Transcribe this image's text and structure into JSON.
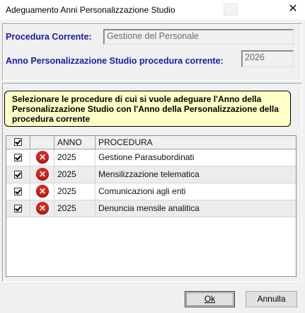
{
  "window": {
    "title": "Adeguamento Anni Personalizzazione Studio"
  },
  "header": {
    "procedura_label": "Procedura Corrente:",
    "procedura_value": "Gestione del Personale",
    "anno_label": "Anno Personalizzazione Studio procedura corrente:",
    "anno_value": "2026"
  },
  "notice": {
    "text": "Selezionare le procedure di cui si vuole adeguare l'Anno della Personalizzazione Studio con l'Anno della Personalizzazione della procedura corrente"
  },
  "grid": {
    "columns": {
      "anno": "ANNO",
      "procedura": "PROCEDURA"
    },
    "rows": [
      {
        "anno": "2025",
        "procedura": "Gestione Parasubordinati",
        "checked": true
      },
      {
        "anno": "2025",
        "procedura": "Mensilizzazione telematica",
        "checked": true
      },
      {
        "anno": "2025",
        "procedura": "Comunicazioni agli enti",
        "checked": true
      },
      {
        "anno": "2025",
        "procedura": "Denuncia mensile analitica",
        "checked": true
      }
    ]
  },
  "buttons": {
    "ok": "Ok",
    "annulla": "Annulla"
  },
  "colors": {
    "label_blue": "#1a1aa6",
    "notice_bg": "#ffffc8",
    "error_red": "#d9261c"
  }
}
